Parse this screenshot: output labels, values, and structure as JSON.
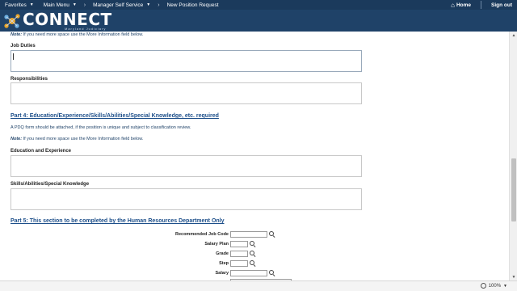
{
  "nav": {
    "favorites": "Favorites",
    "main_menu": "Main Menu",
    "crumb1": "Manager Self Service",
    "crumb2": "New Position Request",
    "home": "Home",
    "signout": "Sign out"
  },
  "banner": {
    "logo_word": "CONNECT",
    "logo_sub": "Maryland Judiciary"
  },
  "form": {
    "note_prefix": "Note:",
    "note_text": " If you need more space use the More Information field below.",
    "job_duties_label": "Job Duties",
    "responsibilities_label": "Responsibilities",
    "part4_title": "Part 4: Education/Experience/Skills/Abilities/Special Knowledge, etc. required",
    "pdq_text": "A PDQ form should be attached, if the position is unique and subject to classification review.",
    "education_label": "Education and Experience",
    "skills_label": "Skills/Abilities/Special Knowledge",
    "part5_title": "Part 5: This section to be completed by the Human Resources Department Only",
    "hr_fields": {
      "recommended_job_code": "Recommended Job Code",
      "salary_plan": "Salary Plan",
      "grade": "Grade",
      "step": "Step",
      "salary": "Salary"
    }
  },
  "status": {
    "zoom": "100%"
  },
  "colors": {
    "nav_bg": "#1b3a5c",
    "banner_bg": "#1f4268",
    "section_title": "#1d4f8a"
  }
}
